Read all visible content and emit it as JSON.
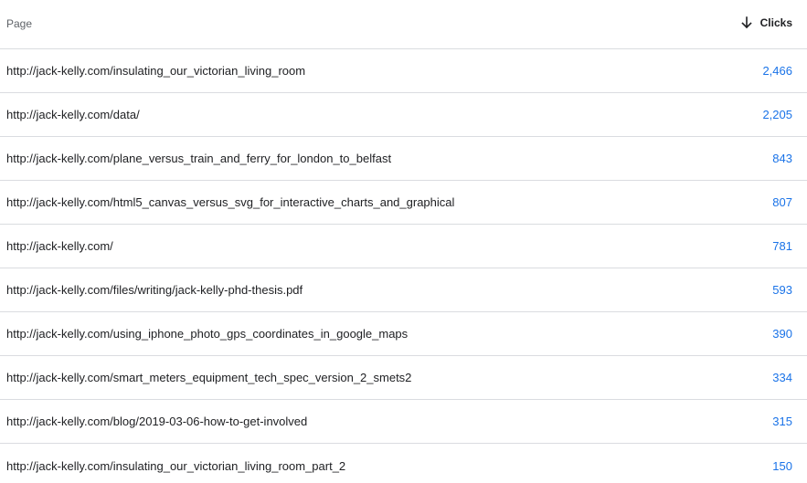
{
  "header": {
    "page_label": "Page",
    "clicks_label": "Clicks",
    "sort_icon": "arrow-down-icon"
  },
  "rows": [
    {
      "page": "http://jack-kelly.com/insulating_our_victorian_living_room",
      "clicks": "2,466"
    },
    {
      "page": "http://jack-kelly.com/data/",
      "clicks": "2,205"
    },
    {
      "page": "http://jack-kelly.com/plane_versus_train_and_ferry_for_london_to_belfast",
      "clicks": "843"
    },
    {
      "page": "http://jack-kelly.com/html5_canvas_versus_svg_for_interactive_charts_and_graphical",
      "clicks": "807"
    },
    {
      "page": "http://jack-kelly.com/",
      "clicks": "781"
    },
    {
      "page": "http://jack-kelly.com/files/writing/jack-kelly-phd-thesis.pdf",
      "clicks": "593"
    },
    {
      "page": "http://jack-kelly.com/using_iphone_photo_gps_coordinates_in_google_maps",
      "clicks": "390"
    },
    {
      "page": "http://jack-kelly.com/smart_meters_equipment_tech_spec_version_2_smets2",
      "clicks": "334"
    },
    {
      "page": "http://jack-kelly.com/blog/2019-03-06-how-to-get-involved",
      "clicks": "315"
    },
    {
      "page": "http://jack-kelly.com/insulating_our_victorian_living_room_part_2",
      "clicks": "150"
    }
  ],
  "colors": {
    "link_blue": "#1a73e8",
    "divider": "#dadce0",
    "header_text": "#5f6368"
  }
}
